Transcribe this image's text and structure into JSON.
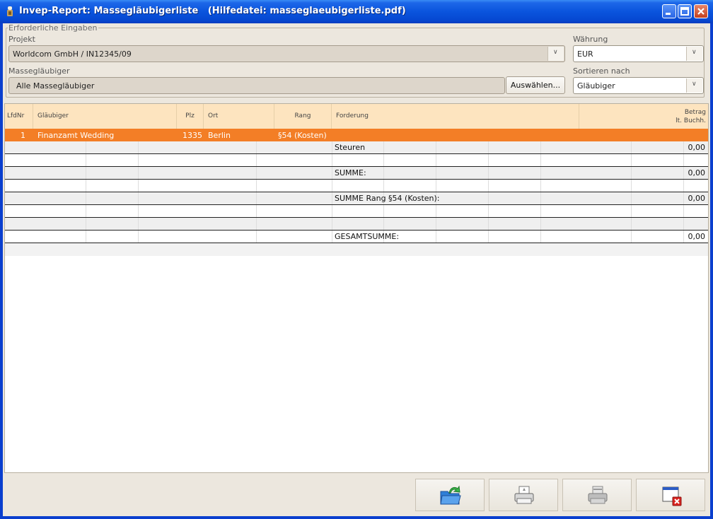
{
  "window": {
    "title": "Invep-Report: Massegläubigerliste   (Hilfedatei: masseglaeubigerliste.pdf)"
  },
  "form": {
    "legend": "Erforderliche Eingaben",
    "projekt_label": "Projekt",
    "projekt_value": "Worldcom GmbH / IN12345/09",
    "waehrung_label": "Währung",
    "waehrung_value": "EUR",
    "glaeubiger_label": "Massegläubiger",
    "glaeubiger_value": "Alle Massegläubiger",
    "auswaehlen_label": "Auswählen...",
    "sortieren_label": "Sortieren nach",
    "sortieren_value": "Gläubiger"
  },
  "table": {
    "headers": {
      "lfdnr": "LfdNr",
      "glaeubiger": "Gläubiger",
      "plz": "Plz",
      "ort": "Ort",
      "rang": "Rang",
      "forderung": "Forderung",
      "betrag_1": "Betrag",
      "betrag_2": "lt. Buchh."
    },
    "selected_row": {
      "lfdnr": "1",
      "glaeubiger": "Finanzamt Wedding",
      "plz": "1335",
      "ort": "Berlin",
      "rang": "§54 (Kosten)"
    },
    "lines": [
      {
        "label": "Steuren",
        "amount": "0,00"
      },
      {
        "label": "",
        "amount": ""
      },
      {
        "label": "SUMME:",
        "amount": "0,00"
      },
      {
        "label": "",
        "amount": ""
      },
      {
        "label": "SUMME  Rang  §54 (Kosten):",
        "amount": "0,00"
      },
      {
        "label": "",
        "amount": ""
      },
      {
        "label": "",
        "amount": ""
      },
      {
        "label": "GESAMTSUMME:",
        "amount": "0,00"
      }
    ]
  },
  "colors": {
    "title_bar": "#0a54dd",
    "header_bg": "#fde4bf",
    "selected_row": "#f37e26",
    "client_bg": "#ece7de"
  },
  "icons": [
    "app-icon",
    "minimize-icon",
    "maximize-icon",
    "close-icon",
    "export-icon",
    "print-icon",
    "print-preview-icon",
    "close-window-icon",
    "dropdown-arrow-icon"
  ]
}
